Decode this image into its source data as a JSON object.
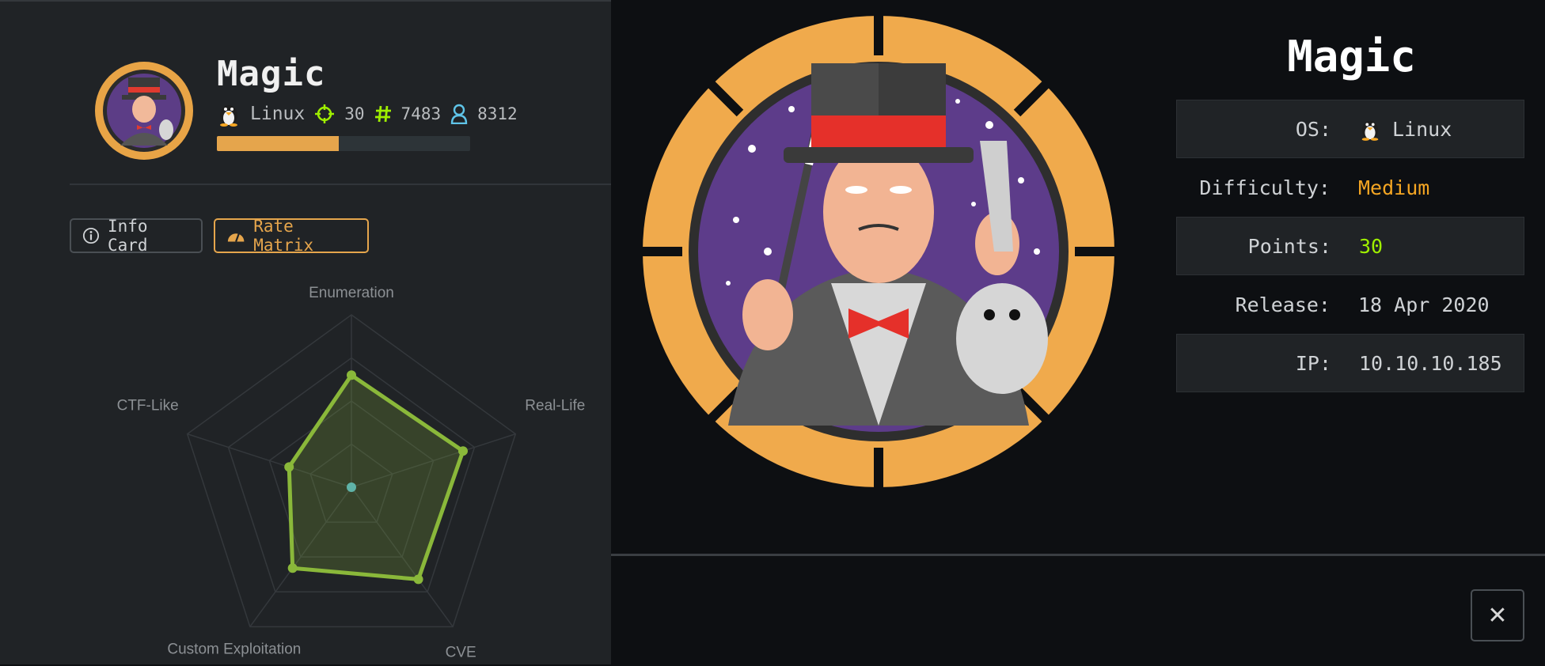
{
  "machine": {
    "name": "Magic",
    "os": "Linux",
    "points": "30",
    "root_owns": "7483",
    "user_owns": "8312",
    "difficulty_progress": 0.48
  },
  "tabs": {
    "info_card": "Info Card",
    "rate_matrix": "Rate Matrix"
  },
  "details": {
    "title": "Magic",
    "rows": [
      {
        "label": "OS:",
        "value": "Linux"
      },
      {
        "label": "Difficulty:",
        "value": "Medium"
      },
      {
        "label": "Points:",
        "value": "30"
      },
      {
        "label": "Release:",
        "value": "18 Apr 2020"
      },
      {
        "label": "IP:",
        "value": "10.10.10.185"
      }
    ]
  },
  "colors": {
    "accent": "#e5a54c",
    "radar": "#8ab83a",
    "medium": "#f5a623",
    "points": "#9fef00"
  },
  "icons": [
    "linux-penguin-icon",
    "crosshair-icon",
    "hash-icon",
    "user-icon",
    "info-icon",
    "gauge-icon",
    "close-icon"
  ],
  "chart_data": {
    "type": "radar",
    "axes": [
      "Enumeration",
      "Real-Life",
      "CVE",
      "Custom Exploitation",
      "CTF-Like"
    ],
    "values": [
      6.5,
      6.8,
      6.6,
      5.8,
      3.8
    ],
    "range": [
      0,
      10
    ]
  },
  "close_label": "✕"
}
